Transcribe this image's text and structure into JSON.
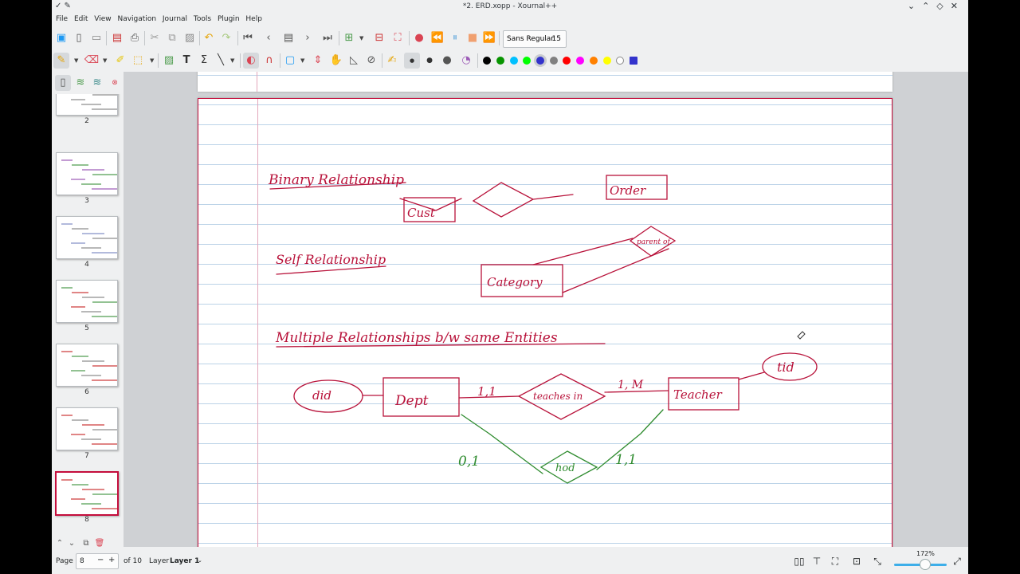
{
  "window": {
    "title": "*2. ERD.xopp - Xournal++"
  },
  "menu": [
    "File",
    "Edit",
    "View",
    "Navigation",
    "Journal",
    "Tools",
    "Plugin",
    "Help"
  ],
  "toolbar": {
    "font_name": "Sans Regular",
    "font_size": "15"
  },
  "pen_colors": [
    "#000000",
    "#079400",
    "#00c0ff",
    "#00ff00",
    "#3333cc",
    "#808080",
    "#ff0000",
    "#ff00ff",
    "#ff8000",
    "#ffff00",
    "#ffffff",
    "#3333cc"
  ],
  "sidebar": {
    "page_numbers": [
      "2",
      "3",
      "4",
      "5",
      "6",
      "7",
      "8"
    ]
  },
  "notes": {
    "heading_binary": "Binary Relationship",
    "entity_cust": "Cust",
    "entity_order": "Order",
    "heading_self": "Self Relationship",
    "entity_category": "Category",
    "rel_parent_of": "parent of",
    "heading_multiple": "Multiple Relationships b/w same Entities",
    "attr_did": "did",
    "entity_dept": "Dept",
    "card_dept_teaches": "1,1",
    "rel_teaches_in": "teaches in",
    "card_teaches_teacher": "1, M",
    "entity_teacher": "Teacher",
    "attr_tid": "tid",
    "card_dept_hod": "0,1",
    "rel_hod": "hod",
    "card_hod_teacher": "1,1"
  },
  "status": {
    "page_label": "Page",
    "page_value": "8",
    "of_pages": "of 10",
    "layer_label": "Layer",
    "layer_value": "Layer 1",
    "zoom": "172%"
  }
}
